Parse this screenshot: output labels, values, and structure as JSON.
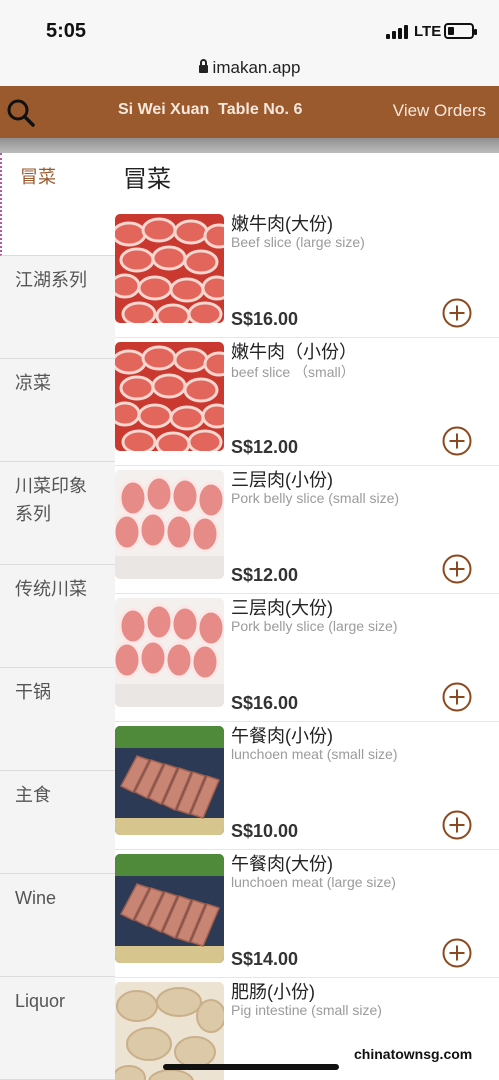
{
  "status": {
    "time": "5:05",
    "network": "LTE"
  },
  "browser": {
    "url": "imakan.app"
  },
  "header": {
    "title": "Si Wei Xuan  Table No. 6",
    "view_orders": "View Orders"
  },
  "sidebar": {
    "items": [
      {
        "label": "冒菜",
        "active": true
      },
      {
        "label": "江湖系列"
      },
      {
        "label": "凉菜"
      },
      {
        "label": "川菜印象系列"
      },
      {
        "label": "传统川菜"
      },
      {
        "label": "干锅"
      },
      {
        "label": "主食"
      },
      {
        "label": "Wine"
      },
      {
        "label": "Liquor"
      }
    ]
  },
  "main": {
    "category_title": "冒菜",
    "items": [
      {
        "name": "嫩牛肉(大份)",
        "sub": "Beef slice (large size)",
        "price": "S$16.00",
        "image": "beef-rolls"
      },
      {
        "name": "嫩牛肉（小份）",
        "sub": "beef slice （small）",
        "price": "S$12.00",
        "image": "beef-rolls"
      },
      {
        "name": "三层肉(小份)",
        "sub": "Pork belly slice (small size)",
        "price": "S$12.00",
        "image": "pork-rolls"
      },
      {
        "name": "三层肉(大份)",
        "sub": "Pork belly slice (large size)",
        "price": "S$16.00",
        "image": "pork-rolls"
      },
      {
        "name": "午餐肉(小份)",
        "sub": "lunchoen meat (small size)",
        "price": "S$10.00",
        "image": "luncheon-meat"
      },
      {
        "name": "午餐肉(大份)",
        "sub": "lunchoen meat (large size)",
        "price": "S$14.00",
        "image": "luncheon-meat"
      },
      {
        "name": "肥肠(小份)",
        "sub": "Pig intestine (small size)",
        "price": "",
        "image": "intestine"
      }
    ]
  },
  "watermark": "chinatownsg.com",
  "colors": {
    "header_bg": "#9a5a2e",
    "accent": "#9a5a2e",
    "add_button": "#8a4a1e"
  }
}
